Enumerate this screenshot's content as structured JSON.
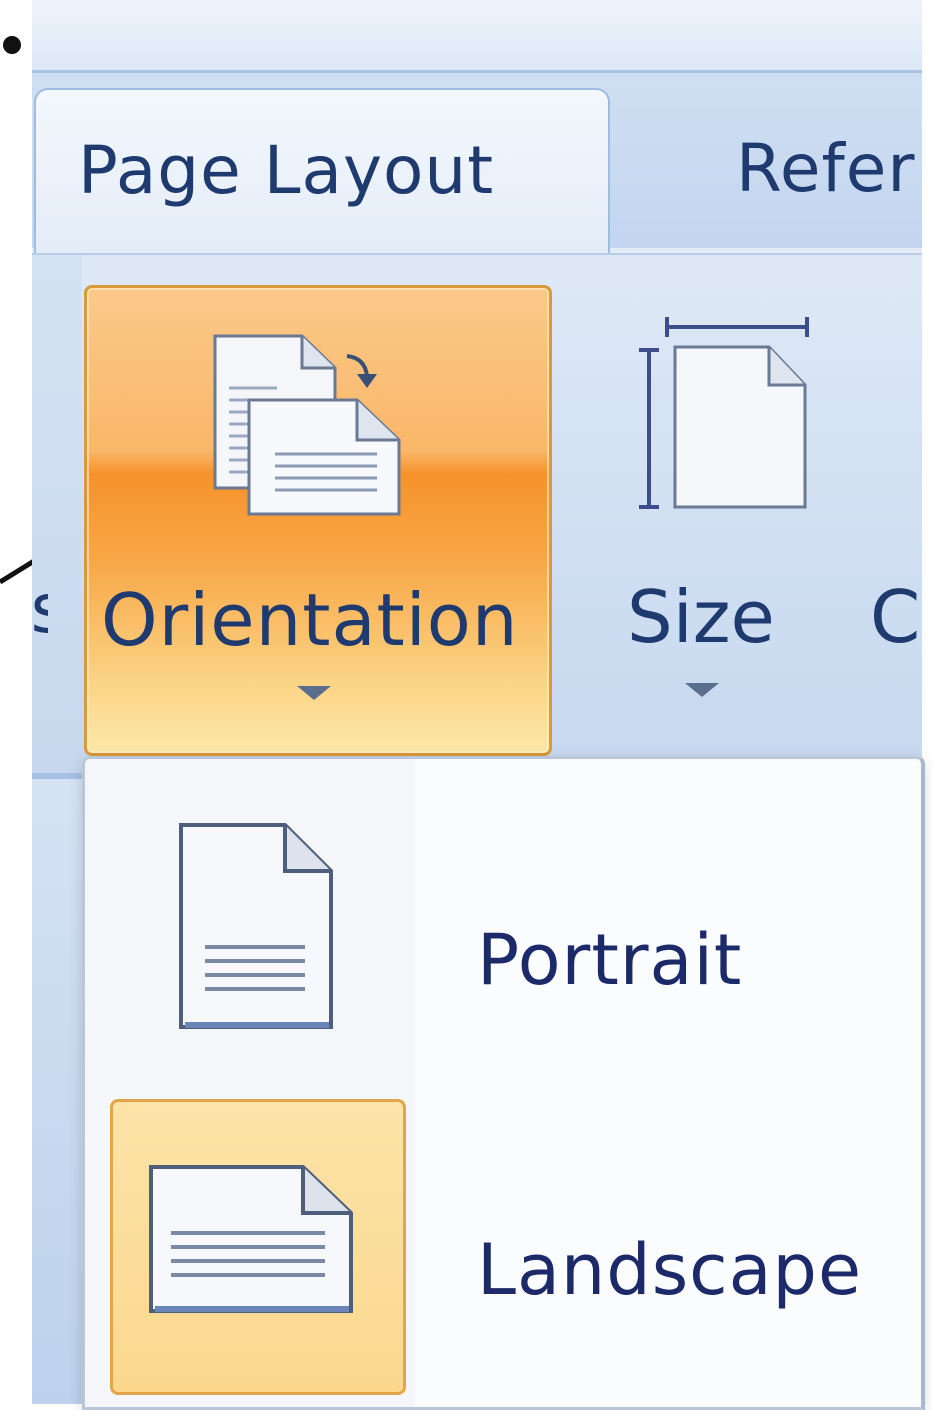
{
  "tabs": {
    "page_layout": "Page Layout",
    "references_partial": "Refer"
  },
  "ribbon": {
    "prev_label_partial": "s",
    "orientation_label": "Orientation",
    "size_label": "Size",
    "next_label_partial": "C"
  },
  "orientation_menu": {
    "items": [
      {
        "label": "Portrait",
        "icon": "portrait-page-icon",
        "highlighted": false
      },
      {
        "label": "Landscape",
        "icon": "landscape-page-icon",
        "highlighted": true
      }
    ]
  },
  "colors": {
    "text": "#1f3a6e",
    "menu_text": "#1c2a6a",
    "button_active_orange": "#f6922a",
    "highlight_border": "#e2a54a",
    "ribbon_blue": "#cfdef2"
  },
  "icons": {
    "orientation": "orientation-pages-icon",
    "size": "page-size-icon",
    "dropdown": "chevron-down-icon",
    "callout": "callout-arrow-icon"
  }
}
